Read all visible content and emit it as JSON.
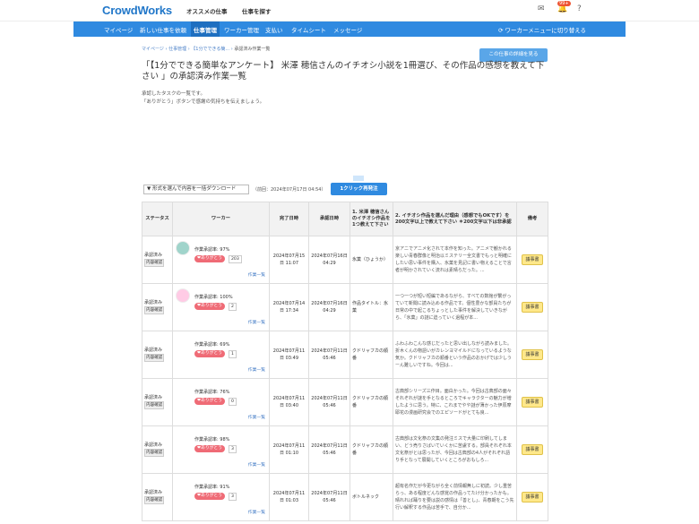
{
  "header": {
    "logo": "CrowdWorks",
    "links": [
      "オススメの仕事",
      "仕事を探す"
    ],
    "notif_count": "99+"
  },
  "nav": {
    "items": [
      "マイページ",
      "新しい仕事を依頼",
      "仕事管理",
      "ワーカー管理",
      "支払い",
      "タイムシート",
      "メッセージ"
    ],
    "switch": "ワーカーメニューに切り替える"
  },
  "breadcrumb": [
    "マイページ",
    "仕事管理",
    "【1分でできる簡...",
    "承認済み作業一覧"
  ],
  "detail_button": "この仕事の詳細を見る",
  "title": "「【1分でできる簡単なアンケート】 米澤 穂信さんのイチオシ小説を1冊選び、その作品の感想を教えて下さい 」の承認済み作業一覧",
  "desc": [
    "承認したタスクの一覧です。",
    "「ありがとう」ボタンで感謝の気持ちを伝えましょう。"
  ],
  "download": {
    "select": "▼ 形式を選んで内容を一括ダウンロード",
    "note": "（前回：2024年07月17日 04:54）",
    "oneclick": "1クリック再発注"
  },
  "table": {
    "headers": [
      "ステータス",
      "ワーカー",
      "完了日時",
      "承認日時",
      "1. 米澤 穂信さんのイチオシ作品を1つ教えて下さい",
      "2. イチオシ作品を選んだ理由（感想でもOKです）を200文字以上で教えて下さい ＊200文字以下は非承認",
      "備考"
    ],
    "rows": [
      {
        "status": "承認済み",
        "confirm": "内容確認",
        "rate": "作業承認率: 97%",
        "thanks": "❤ありがとう",
        "count": "203",
        "list": "作業一覧",
        "done": "2024年07月15日 11:07",
        "approved": "2024年07月16日 04:29",
        "a1": "氷菓（ひょうか）",
        "a2": "京アニでアニメ化されて本作を知った。アニメで観かれる楽しい青春群像と明治以ミステリー全文書でもっと明確にしたい思い事件を購入、氷菓を見記に書い物えることで言者が明かされていく流れは素晴らだった。...",
        "memo": "議事書",
        "av": "#4a9"
      },
      {
        "status": "承認済み",
        "confirm": "内容確認",
        "rate": "作業承認率: 100%",
        "thanks": "❤ありがとう",
        "count": "2",
        "list": "作業一覧",
        "done": "2024年07月14日 17:34",
        "approved": "2024年07月16日 04:29",
        "a1": "作品タイトル：氷菓",
        "a2": "一つ一つが短い短編であるながら、すべての数館が繋がっていて新聞に読み込める作品です。個性豊かな部員たちが日常の中で起こるちょっとした事件を解決していきながら、「氷菓」の謎に迫っていく過程が本...",
        "memo": "議事書",
        "av": "#f9c"
      },
      {
        "status": "承認済み",
        "confirm": "内容確認",
        "rate": "作業承認率: 69%",
        "thanks": "❤ありがとう",
        "count": "1",
        "list": "作業一覧",
        "done": "2024年07月11日 03:49",
        "approved": "2024年07月11日 05:46",
        "a1": "クドリャフカの順番",
        "a2": "ふわふわこんな感じだったと思い出しながら読みました。折木くんの物語いがカレンヨマイルドになっているような気か。クドリャフカの順番という作品のおかげでは少しうーん難しいですね。今回は...",
        "memo": "議事書",
        "av": ""
      },
      {
        "status": "承認済み",
        "confirm": "内容確認",
        "rate": "作業承認率: 76%",
        "thanks": "❤ありがとう",
        "count": "0",
        "list": "作業一覧",
        "done": "2024年07月11日 03:40",
        "approved": "2024年07月11日 05:46",
        "a1": "クドリャフカの順番",
        "a2": "古典部シリーズ三作目。面白かった。今回は古典部の面々それぞれが謎を手となるところでキャラクターの魅力が増したように思う。特に、これまでやや謎が薄かった伊原摩耶花の漫画研究会でのエピソードがとても良...",
        "memo": "議事書",
        "av": ""
      },
      {
        "status": "承認済み",
        "confirm": "内容確認",
        "rate": "作業承認率: 98%",
        "thanks": "❤ありがとう",
        "count": "3",
        "list": "作業一覧",
        "done": "2024年07月11日 01:10",
        "approved": "2024年07月11日 05:46",
        "a1": "クドリャフカの順番",
        "a2": "古典部は文化祭の文集の発注ミスで大量に印刷してしまい、どう売りさばいていくかに苦慮する。部員それぞれ本文化祭がとは思ったが、今回は古典部の4人がそれぞれ語り手となって展開していくところがおもしろ...",
        "memo": "議事書",
        "av": ""
      },
      {
        "status": "承認済み",
        "confirm": "内容確認",
        "rate": "作業承認率: 91%",
        "thanks": "❤ありがとう",
        "count": "3",
        "list": "作業一覧",
        "done": "2024年07月11日 01:03",
        "approved": "2024年07月11日 05:46",
        "a1": "ボトルネック",
        "a2": "超有名作だが今更ながら全く前情報無しに初読。少し重苦らっ、ある程度どんな感覚の作品ってたけ分かったかも。晴れれば踊りを要は説の感情は「善とし」、青春期をこう先行い解釈する作品は苦手で、自分か...",
        "memo": "議事書",
        "av": ""
      }
    ]
  }
}
